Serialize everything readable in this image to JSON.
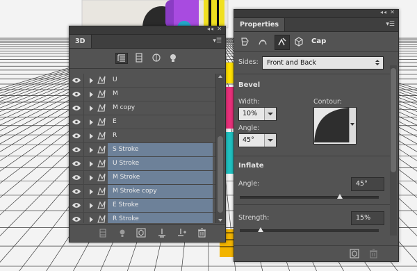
{
  "panel_3d": {
    "tab_label": "3D",
    "layers": [
      {
        "name": "U",
        "selected": false
      },
      {
        "name": "M",
        "selected": false
      },
      {
        "name": "M copy",
        "selected": false
      },
      {
        "name": "E",
        "selected": false
      },
      {
        "name": "R",
        "selected": false
      },
      {
        "name": "S Stroke",
        "selected": true
      },
      {
        "name": "U Stroke",
        "selected": true
      },
      {
        "name": "M Stroke",
        "selected": true
      },
      {
        "name": "M Stroke copy",
        "selected": true
      },
      {
        "name": "E Stroke",
        "selected": true
      },
      {
        "name": "R Stroke",
        "selected": true
      }
    ],
    "toolbar_icons": [
      "scene-filter-icon",
      "mesh-filter-icon",
      "material-filter-icon",
      "light-filter-icon"
    ],
    "bottom_icons": [
      "render-icon",
      "add-light-icon",
      "render-button-icon",
      "ground-icon",
      "new-light-icon",
      "delete-icon"
    ]
  },
  "properties": {
    "tab_label": "Properties",
    "section_title": "Cap",
    "sides_label": "Sides:",
    "sides_value": "Front and Back",
    "bevel": {
      "title": "Bevel",
      "width_label": "Width:",
      "width_value": "10%",
      "contour_label": "Contour:",
      "angle_label": "Angle:",
      "angle_value": "45°"
    },
    "inflate": {
      "title": "Inflate",
      "angle_label": "Angle:",
      "angle_value": "45°",
      "angle_slider": 0.72,
      "strength_label": "Strength:",
      "strength_value": "15%",
      "strength_slider": 0.15
    }
  },
  "colors": {
    "panel": "#535353",
    "selected_row": "#6d8199",
    "canvas": "#f4f4f4"
  }
}
